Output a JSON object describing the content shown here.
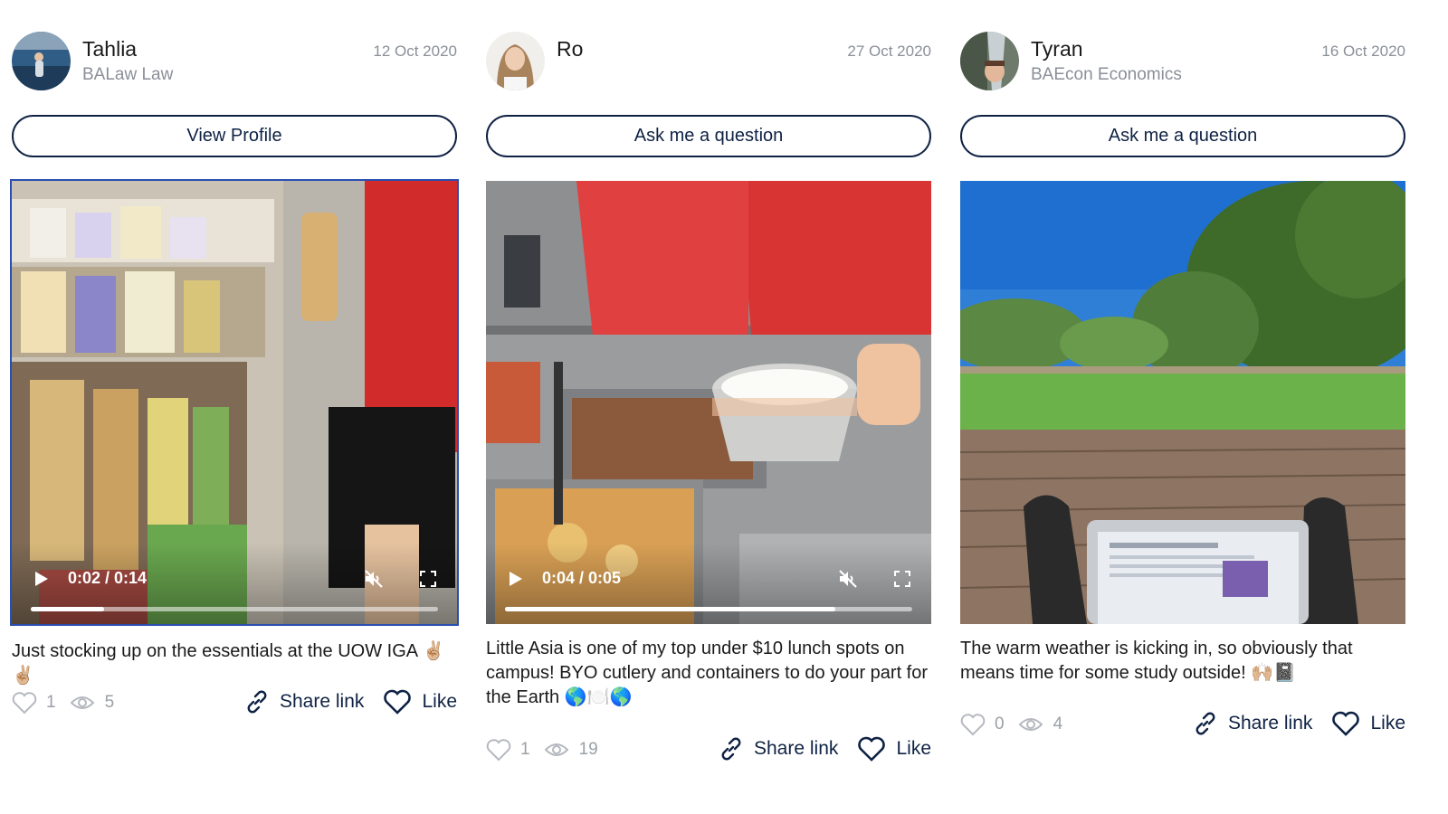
{
  "posts": [
    {
      "author": "Tahlia",
      "degree": "BALaw Law",
      "date": "12 Oct 2020",
      "button_label": "View Profile",
      "media_type": "video",
      "video": {
        "time": "0:02 / 0:14",
        "progress": 0.18
      },
      "caption": "Just stocking up on the essentials at the UOW IGA ✌🏼✌🏼",
      "likes": "1",
      "views": "5",
      "share_label": "Share link",
      "like_label": "Like"
    },
    {
      "author": "Ro",
      "degree": "",
      "date": "27 Oct 2020",
      "button_label": "Ask me a question",
      "media_type": "video",
      "video": {
        "time": "0:04 / 0:05",
        "progress": 0.81
      },
      "caption": "Little Asia is one of my top under $10 lunch spots on campus! BYO cutlery and containers to do your part for the Earth 🌎🍽️🌎",
      "likes": "1",
      "views": "19",
      "share_label": "Share link",
      "like_label": "Like"
    },
    {
      "author": "Tyran",
      "degree": "BAEcon Economics",
      "date": "16 Oct 2020",
      "button_label": "Ask me a question",
      "media_type": "image",
      "caption": "The warm weather is kicking in, so obviously that means time for some study outside! 🙌🏼📓",
      "likes": "0",
      "views": "4",
      "share_label": "Share link",
      "like_label": "Like"
    }
  ],
  "icons": {
    "play": "play-icon",
    "mute": "muted-speaker-icon",
    "fullscreen": "fullscreen-icon",
    "heart": "heart-icon",
    "eye": "eye-icon",
    "link": "link-icon"
  },
  "colors": {
    "primary": "#0f2244",
    "muted_text": "#8a8f98",
    "stat_text": "#9aa0a6",
    "video_focus": "#2a4fb0"
  }
}
